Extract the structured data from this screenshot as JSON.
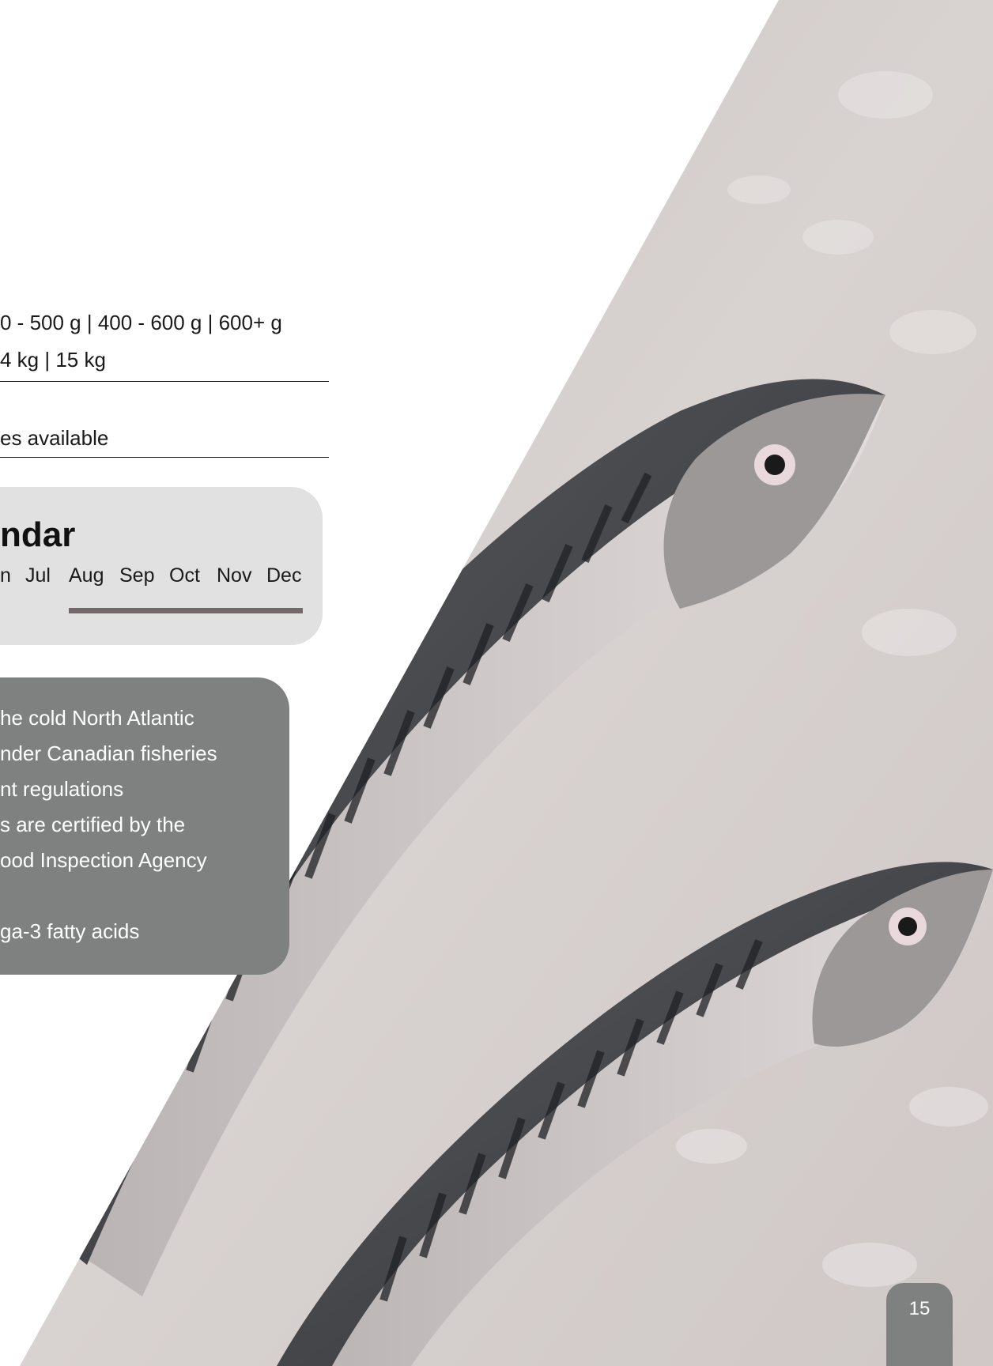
{
  "specs": {
    "sizes": "0 - 500 g  |  400 - 600 g  |  600+ g",
    "packaging": "4 kg  |  15 kg",
    "availability": "es available"
  },
  "calendar": {
    "title": "ndar",
    "months": [
      "n",
      "Jul",
      "Aug",
      "Sep",
      "Oct",
      "Nov",
      "Dec"
    ],
    "season_start": "Aug",
    "season_end": "Dec",
    "bar_color": "#75686a"
  },
  "info": {
    "lines": [
      "he cold North Atlantic",
      "nder Canadian fisheries",
      "nt regulations",
      "s are certified by the",
      "ood Inspection Agency",
      "ga-3 fatty acids"
    ]
  },
  "page_number": "15",
  "colors": {
    "calendar_bg": "#e0e1e0",
    "info_bg": "#7f8080",
    "tab_bg": "#7f8080"
  },
  "image": {
    "subject": "two-mackerel-on-ice"
  }
}
